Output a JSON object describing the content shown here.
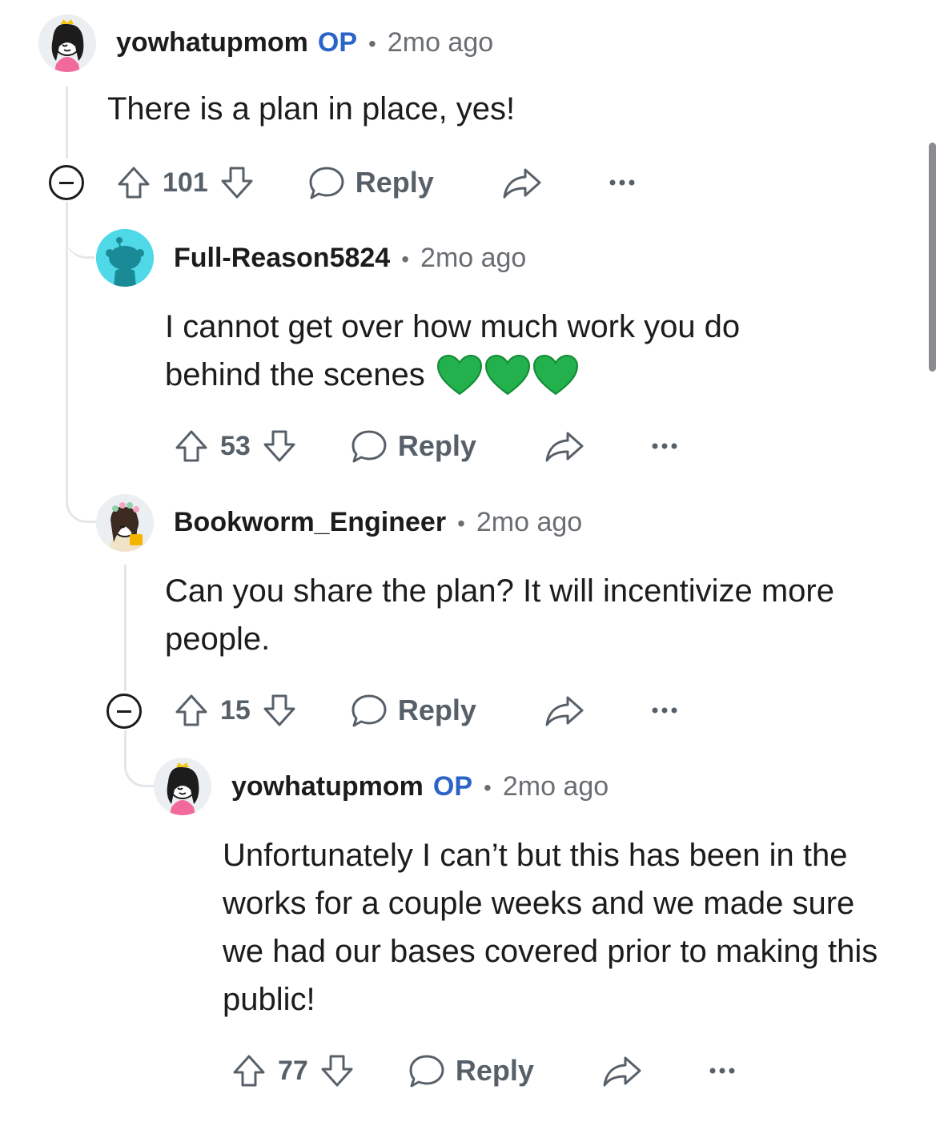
{
  "comments": [
    {
      "username": "yowhatupmom",
      "op_label": "OP",
      "separator": "•",
      "time": "2mo ago",
      "text": "There is a plan in place, yes!",
      "votes": "101",
      "reply_label": "Reply"
    },
    {
      "username": "Full-Reason5824",
      "separator": "•",
      "time": "2mo ago",
      "text_line1": "I cannot get over how much work you do",
      "text_line2": "behind the scenes",
      "emoji": "💚💚💚",
      "votes": "53",
      "reply_label": "Reply"
    },
    {
      "username": "Bookworm_Engineer",
      "separator": "•",
      "time": "2mo ago",
      "text": "Can you share the plan? It will incentivize more people.",
      "votes": "15",
      "reply_label": "Reply"
    },
    {
      "username": "yowhatupmom",
      "op_label": "OP",
      "separator": "•",
      "time": "2mo ago",
      "text": "Unfortunately I can’t but this has been in the works for a couple weeks and we made sure we had our bases covered prior to making this public!",
      "votes": "77",
      "reply_label": "Reply"
    }
  ],
  "colors": {
    "op": "#2b64c8",
    "meta": "#6a6e73",
    "action": "#576069",
    "thread_line": "#e5e6e8",
    "heart": "#22b14c"
  },
  "icons": [
    "upvote-icon",
    "downvote-icon",
    "comment-bubble-icon",
    "share-icon",
    "more-options-icon",
    "collapse-icon"
  ]
}
